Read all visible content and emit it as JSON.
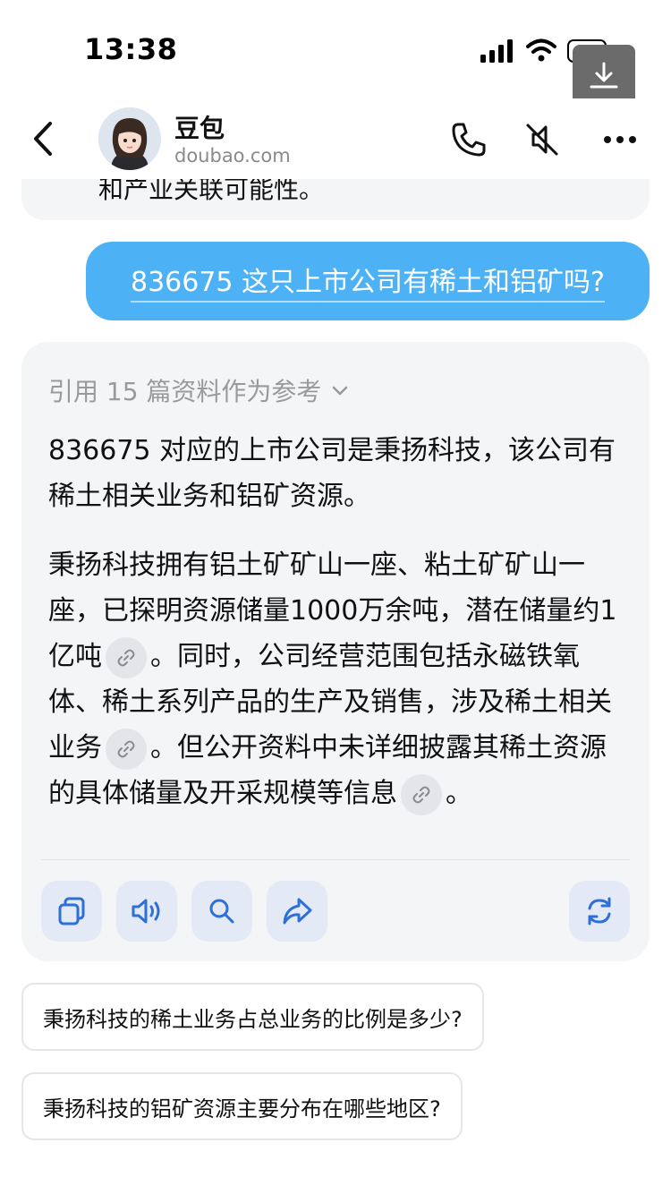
{
  "status_bar": {
    "time": "13:38"
  },
  "header": {
    "bot_name": "豆包",
    "bot_domain": "doubao.com"
  },
  "prev_message": {
    "text_fragment": "和产业关联可能性。"
  },
  "user_message": {
    "text": "836675 这只上市公司有稀土和铝矿吗?"
  },
  "answer": {
    "references_label": "引用 15 篇资料作为参考",
    "para1": "836675 对应的上市公司是秉扬科技，该公司有稀土相关业务和铝矿资源。",
    "para2_part1": "秉扬科技拥有铝土矿矿山一座、粘土矿矿山一座，已探明资源储量1000万余吨，潜在储量约1亿吨",
    "para2_part2": "。同时，公司经营范围包括永磁铁氧体、稀土系列产品的生产及销售，涉及稀土相关业务",
    "para2_part3": "。但公开资料中未详细披露其稀土资源的具体储量及开采规模等信息",
    "para2_part4": "。"
  },
  "actions": [
    "copy-icon",
    "speaker-icon",
    "search-icon",
    "share-icon",
    "regenerate-icon"
  ],
  "suggestions": [
    "秉扬科技的稀土业务占总业务的比例是多少?",
    "秉扬科技的铝矿资源主要分布在哪些地区?"
  ],
  "colors": {
    "user_bubble": "#4db1f5",
    "card_bg": "#f4f5f7",
    "action_bg": "#e3eaf5",
    "accent_icon": "#2e6fd8"
  }
}
